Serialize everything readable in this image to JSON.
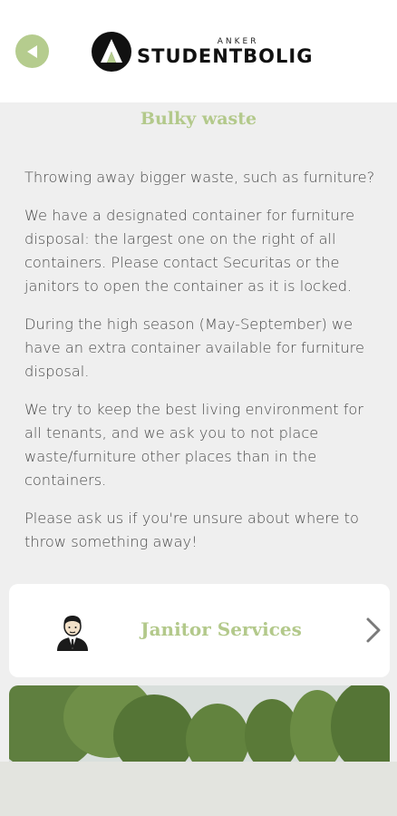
{
  "header": {
    "back_icon": "back-arrow-icon",
    "logo_small": "ANKER",
    "logo_big": "STUDENTBOLIG"
  },
  "page": {
    "title": "Bulky waste",
    "paragraphs": [
      "Throwing away bigger waste, such as furniture?",
      "We have a designated container for furniture disposal: the largest one on the right of all containers. Please contact Securitas or the janitors to open the container as it is locked.",
      "During the high season (May-September) we have an extra container available for furniture disposal.",
      "We try to keep the best living environment for all tenants, and we ask you to not place waste/furniture other places than in the containers.",
      "Please ask us if you're unsure about where to throw something away!"
    ]
  },
  "janitor_card": {
    "label": "Janitor Services",
    "icon": "janitor-person-icon",
    "chevron": "chevron-right-icon"
  },
  "colors": {
    "accent": "#b3c98b",
    "background": "#efefef",
    "text": "#4a4a4a"
  }
}
